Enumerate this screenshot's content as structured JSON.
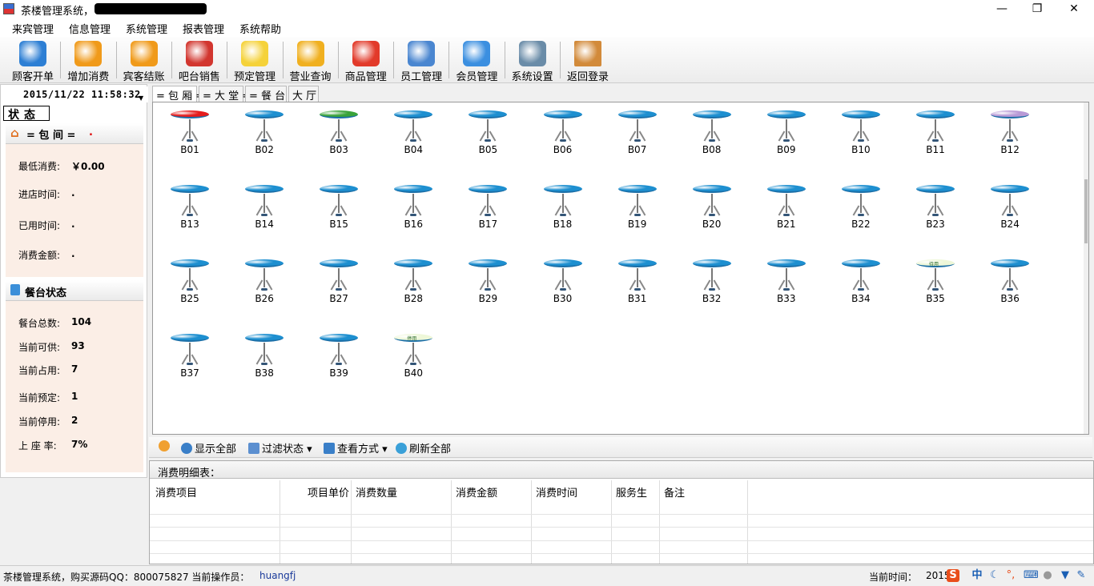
{
  "window": {
    "title": "茶楼管理系统，",
    "minimize": "—",
    "maximize": "❐",
    "close": "✕"
  },
  "menu": [
    "来宾管理",
    "信息管理",
    "系统管理",
    "报表管理",
    "系统帮助"
  ],
  "toolbar": [
    {
      "label": "顾客开单",
      "icon": "open-order-icon"
    },
    {
      "label": "增加消费",
      "icon": "add-consume-icon"
    },
    {
      "label": "宾客结账",
      "icon": "checkout-icon"
    },
    {
      "label": "吧台销售",
      "icon": "bar-sales-icon"
    },
    {
      "label": "预定管理",
      "icon": "reservation-icon"
    },
    {
      "label": "营业查询",
      "icon": "business-query-icon"
    },
    {
      "label": "商品管理",
      "icon": "goods-icon"
    },
    {
      "label": "员工管理",
      "icon": "staff-icon"
    },
    {
      "label": "会员管理",
      "icon": "member-icon"
    },
    {
      "label": "系统设置",
      "icon": "settings-icon"
    },
    {
      "label": "返回登录",
      "icon": "exit-icon"
    }
  ],
  "left": {
    "datetime": "2015/11/22  11:58:32",
    "status_tab": "状态",
    "room_header": "= 包  间 =",
    "room_header_dot": ".",
    "room_fields": [
      {
        "label": "最低消费:",
        "value": "￥0.00"
      },
      {
        "label": "进店时间:",
        "value": "."
      },
      {
        "label": "已用时间:",
        "value": "."
      },
      {
        "label": "消费金额:",
        "value": "."
      }
    ],
    "table_header": "餐台状态",
    "table_fields": [
      {
        "label": "餐台总数:",
        "value": "104"
      },
      {
        "label": "当前可供:",
        "value": "93"
      },
      {
        "label": "当前占用:",
        "value": "7"
      },
      {
        "label": "当前预定:",
        "value": "1"
      },
      {
        "label": "当前停用:",
        "value": "2"
      },
      {
        "label": "上 座 率:",
        "value": "7%"
      }
    ]
  },
  "tabs": [
    "= 包 厢 =",
    "= 大 堂 =",
    "= 餐 台 =",
    "大 厅"
  ],
  "seats": [
    {
      "id": "B01",
      "color": "#e51c1c"
    },
    {
      "id": "B02",
      "color": "#1d8fd0"
    },
    {
      "id": "B03",
      "color": "#3aa33a"
    },
    {
      "id": "B04",
      "color": "#1d8fd0"
    },
    {
      "id": "B05",
      "color": "#1d8fd0"
    },
    {
      "id": "B06",
      "color": "#1d8fd0"
    },
    {
      "id": "B07",
      "color": "#1d8fd0"
    },
    {
      "id": "B08",
      "color": "#1d8fd0"
    },
    {
      "id": "B09",
      "color": "#1d8fd0"
    },
    {
      "id": "B10",
      "color": "#1d8fd0"
    },
    {
      "id": "B11",
      "color": "#1d8fd0"
    },
    {
      "id": "B12",
      "color": "#b89ad6"
    },
    {
      "id": "B13",
      "color": "#1d8fd0"
    },
    {
      "id": "B14",
      "color": "#1d8fd0"
    },
    {
      "id": "B15",
      "color": "#1d8fd0"
    },
    {
      "id": "B16",
      "color": "#1d8fd0"
    },
    {
      "id": "B17",
      "color": "#1d8fd0"
    },
    {
      "id": "B18",
      "color": "#1d8fd0"
    },
    {
      "id": "B19",
      "color": "#1d8fd0"
    },
    {
      "id": "B20",
      "color": "#1d8fd0"
    },
    {
      "id": "B21",
      "color": "#1d8fd0"
    },
    {
      "id": "B22",
      "color": "#1d8fd0"
    },
    {
      "id": "B23",
      "color": "#1d8fd0"
    },
    {
      "id": "B24",
      "color": "#1d8fd0"
    },
    {
      "id": "B25",
      "color": "#1d8fd0"
    },
    {
      "id": "B26",
      "color": "#1d8fd0"
    },
    {
      "id": "B27",
      "color": "#1d8fd0"
    },
    {
      "id": "B28",
      "color": "#1d8fd0"
    },
    {
      "id": "B29",
      "color": "#1d8fd0"
    },
    {
      "id": "B30",
      "color": "#1d8fd0"
    },
    {
      "id": "B31",
      "color": "#1d8fd0"
    },
    {
      "id": "B32",
      "color": "#1d8fd0"
    },
    {
      "id": "B33",
      "color": "#1d8fd0"
    },
    {
      "id": "B34",
      "color": "#1d8fd0"
    },
    {
      "id": "B35",
      "color": "#eef7d8",
      "tag": "待用"
    },
    {
      "id": "B36",
      "color": "#1d8fd0"
    },
    {
      "id": "B37",
      "color": "#1d8fd0"
    },
    {
      "id": "B38",
      "color": "#1d8fd0"
    },
    {
      "id": "B39",
      "color": "#1d8fd0"
    },
    {
      "id": "B40",
      "color": "#eef7d8",
      "tag": "停用"
    }
  ],
  "bottombar": [
    "显示全部",
    "过滤状态",
    "查看方式",
    "刷新全部"
  ],
  "detail": {
    "caption": "消费明细表：",
    "columns": [
      "消费项目",
      "项目单价",
      "消费数量",
      "消费金额",
      "消费时间",
      "服务生",
      "备注"
    ]
  },
  "statusbar": {
    "left": "茶楼管理系统，购买源码QQ：800075827  当前操作员：",
    "operator": "huangfj",
    "time_label": "当前时间：",
    "time_value": "2015-"
  }
}
